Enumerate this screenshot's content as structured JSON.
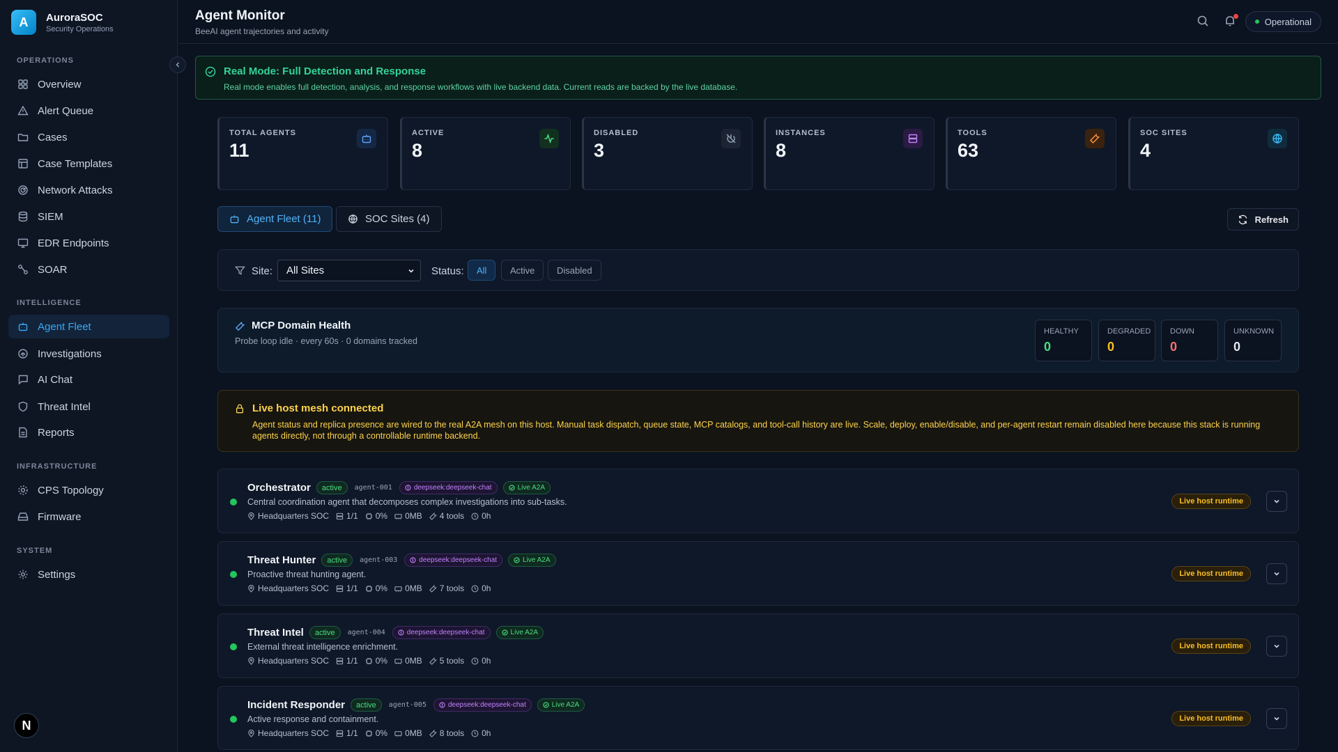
{
  "brand": {
    "logo_letter": "A",
    "name": "AuroraSOC",
    "subtitle": "Security Operations"
  },
  "nav": {
    "operations_label": "OPERATIONS",
    "intelligence_label": "INTELLIGENCE",
    "infrastructure_label": "INFRASTRUCTURE",
    "system_label": "SYSTEM",
    "items": [
      {
        "label": "Overview",
        "icon": "layout-icon"
      },
      {
        "label": "Alert Queue",
        "icon": "alert-triangle-icon"
      },
      {
        "label": "Cases",
        "icon": "folder-icon"
      },
      {
        "label": "Case Templates",
        "icon": "template-icon"
      },
      {
        "label": "Network Attacks",
        "icon": "radar-icon"
      },
      {
        "label": "SIEM",
        "icon": "database-icon"
      },
      {
        "label": "EDR Endpoints",
        "icon": "monitor-icon"
      },
      {
        "label": "SOAR",
        "icon": "workflow-icon"
      },
      {
        "label": "Agent Fleet",
        "icon": "bot-icon",
        "active": true
      },
      {
        "label": "Investigations",
        "icon": "fingerprint-icon"
      },
      {
        "label": "AI Chat",
        "icon": "message-icon"
      },
      {
        "label": "Threat Intel",
        "icon": "shield-icon"
      },
      {
        "label": "Reports",
        "icon": "file-text-icon"
      },
      {
        "label": "CPS Topology",
        "icon": "cog-network-icon"
      },
      {
        "label": "Firmware",
        "icon": "hard-drive-icon"
      },
      {
        "label": "Settings",
        "icon": "gear-icon"
      }
    ],
    "footer_badge": "N"
  },
  "header": {
    "title": "Agent Monitor",
    "subtitle": "BeeAI agent trajectories and activity",
    "status": "Operational"
  },
  "banner": {
    "title": "Real Mode: Full Detection and Response",
    "text": "Real mode enables full detection, analysis, and response workflows with live backend data. Current reads are backed by the live database."
  },
  "stats": [
    {
      "label": "TOTAL AGENTS",
      "value": "11",
      "icon": "bot-icon",
      "color": "#60a5fa"
    },
    {
      "label": "ACTIVE",
      "value": "8",
      "icon": "activity-icon",
      "color": "#4ade80"
    },
    {
      "label": "DISABLED",
      "value": "3",
      "icon": "power-off-icon",
      "color": "#94a3b8"
    },
    {
      "label": "INSTANCES",
      "value": "8",
      "icon": "server-icon",
      "color": "#c084fc"
    },
    {
      "label": "TOOLS",
      "value": "63",
      "icon": "wrench-icon",
      "color": "#fb923c"
    },
    {
      "label": "SOC SITES",
      "value": "4",
      "icon": "globe-icon",
      "color": "#38bdf8"
    }
  ],
  "tabs": {
    "agent_fleet": "Agent Fleet (11)",
    "soc_sites": "SOC Sites (4)",
    "refresh": "Refresh"
  },
  "filters": {
    "site_label": "Site:",
    "site_value": "All Sites",
    "status_label": "Status:",
    "chips": [
      "All",
      "Active",
      "Disabled"
    ]
  },
  "mcp": {
    "title": "MCP Domain Health",
    "subtitle": "Probe loop idle · every 60s · 0 domains tracked",
    "boxes": [
      {
        "label": "HEALTHY",
        "value": "0",
        "color": "#4ade80"
      },
      {
        "label": "DEGRADED",
        "value": "0",
        "color": "#fbbf24"
      },
      {
        "label": "DOWN",
        "value": "0",
        "color": "#f87171"
      },
      {
        "label": "UNKNOWN",
        "value": "0",
        "color": "#e5e7eb"
      }
    ]
  },
  "mesh": {
    "title": "Live host mesh connected",
    "text": "Agent status and replica presence are wired to the real A2A mesh on this host. Manual task dispatch, queue state, MCP catalogs, and tool-call history are live. Scale, deploy, enable/disable, and per-agent restart remain disabled here because this stack is running agents directly, not through a controllable runtime backend."
  },
  "agents": [
    {
      "name": "Orchestrator",
      "status": "active",
      "id": "agent-001",
      "model": "deepseek:deepseek-chat",
      "a2a": "Live A2A",
      "desc": "Central coordination agent that decomposes complex investigations into sub-tasks.",
      "site": "Headquarters SOC",
      "replicas": "1/1",
      "cpu": "0%",
      "mem": "0MB",
      "tools": "4 tools",
      "uptime": "0h",
      "runtime": "Live host runtime"
    },
    {
      "name": "Threat Hunter",
      "status": "active",
      "id": "agent-003",
      "model": "deepseek:deepseek-chat",
      "a2a": "Live A2A",
      "desc": "Proactive threat hunting agent.",
      "site": "Headquarters SOC",
      "replicas": "1/1",
      "cpu": "0%",
      "mem": "0MB",
      "tools": "7 tools",
      "uptime": "0h",
      "runtime": "Live host runtime"
    },
    {
      "name": "Threat Intel",
      "status": "active",
      "id": "agent-004",
      "model": "deepseek:deepseek-chat",
      "a2a": "Live A2A",
      "desc": "External threat intelligence enrichment.",
      "site": "Headquarters SOC",
      "replicas": "1/1",
      "cpu": "0%",
      "mem": "0MB",
      "tools": "5 tools",
      "uptime": "0h",
      "runtime": "Live host runtime"
    },
    {
      "name": "Incident Responder",
      "status": "active",
      "id": "agent-005",
      "model": "deepseek:deepseek-chat",
      "a2a": "Live A2A",
      "desc": "Active response and containment.",
      "site": "Headquarters SOC",
      "replicas": "1/1",
      "cpu": "0%",
      "mem": "0MB",
      "tools": "8 tools",
      "uptime": "0h",
      "runtime": "Live host runtime"
    }
  ]
}
